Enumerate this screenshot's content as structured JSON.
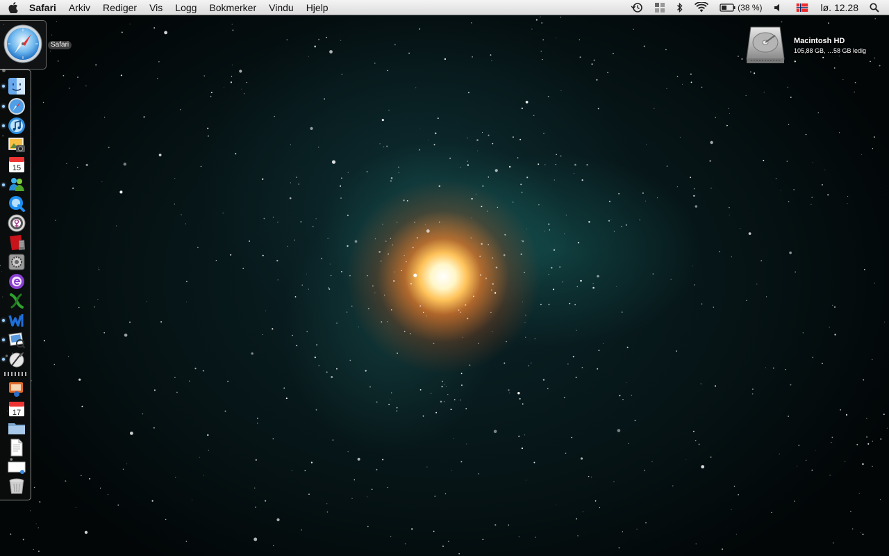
{
  "menubar": {
    "app_name": "Safari",
    "menus": [
      "Arkiv",
      "Rediger",
      "Vis",
      "Logg",
      "Bokmerker",
      "Vindu",
      "Hjelp"
    ],
    "battery": "(38 %)",
    "clock": "lø. 12.28",
    "icons": [
      "apple-icon",
      "time-machine-icon",
      "spaces-icon",
      "bluetooth-icon",
      "wifi-icon",
      "battery-icon",
      "volume-icon",
      "norwegian-flag-icon",
      "spotlight-icon"
    ]
  },
  "dock": {
    "active_app": "Safari",
    "tooltip": "Safari",
    "apps": [
      {
        "icon": "finder-icon",
        "running": true
      },
      {
        "icon": "safari-icon",
        "running": true
      },
      {
        "icon": "itunes-icon",
        "running": true
      },
      {
        "icon": "iphoto-icon",
        "running": false
      },
      {
        "icon": "ical-icon",
        "running": false
      },
      {
        "icon": "messenger-icon",
        "running": true
      },
      {
        "icon": "quicktime-icon",
        "running": false
      },
      {
        "icon": "app-circle-icon",
        "running": false
      },
      {
        "icon": "red-app-icon",
        "running": false
      },
      {
        "icon": "system-preferences-icon",
        "running": false
      },
      {
        "icon": "entourage-icon",
        "running": false
      },
      {
        "icon": "excel-icon",
        "running": false
      },
      {
        "icon": "word-icon",
        "running": true
      },
      {
        "icon": "preview-icon",
        "running": true
      },
      {
        "icon": "script-editor-icon",
        "running": true
      }
    ],
    "stacks": [
      {
        "icon": "stack-app-icon"
      },
      {
        "icon": "stack-ical-icon"
      },
      {
        "icon": "folder-icon"
      },
      {
        "icon": "document-icon"
      },
      {
        "icon": "screenshot-icon"
      },
      {
        "icon": "trash-icon"
      }
    ],
    "calendar_day_1": "15",
    "calendar_day_2": "17"
  },
  "desktop": {
    "hd_name": "Macintosh HD",
    "hd_info": "105,88 GB, …58 GB ledig"
  },
  "colors": {
    "menubar_bg": "#e6e6e6",
    "running_dot": "#9fd0ff"
  }
}
